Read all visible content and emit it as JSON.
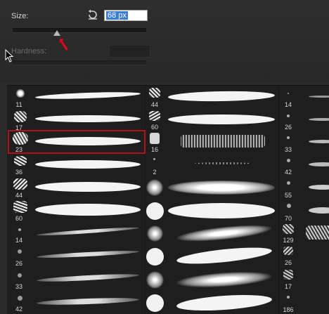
{
  "brush_options": {
    "size_label": "Size:",
    "size_value": "68 px",
    "hardness_label": "Hardness:",
    "size_slider_percent": 33
  },
  "icons": {
    "reset": "reset-icon",
    "cursor": "arrow-cursor-icon",
    "annotation": "red-arrow-annotation-icon"
  },
  "colors": {
    "background": "#2b2b2b",
    "grid_background": "#1e1e1e",
    "selection_border": "#b0121a",
    "input_highlight": "#3d7dd6"
  },
  "brushes": {
    "column1": [
      "11",
      "17",
      "23",
      "36",
      "44",
      "60",
      "14",
      "26",
      "33",
      "42"
    ],
    "column2": [
      "44",
      "60",
      "16",
      "2"
    ],
    "column3": [
      "14",
      "26",
      "33",
      "42",
      "55",
      "70",
      "129",
      "26",
      "17",
      "186"
    ],
    "selected": "23"
  }
}
